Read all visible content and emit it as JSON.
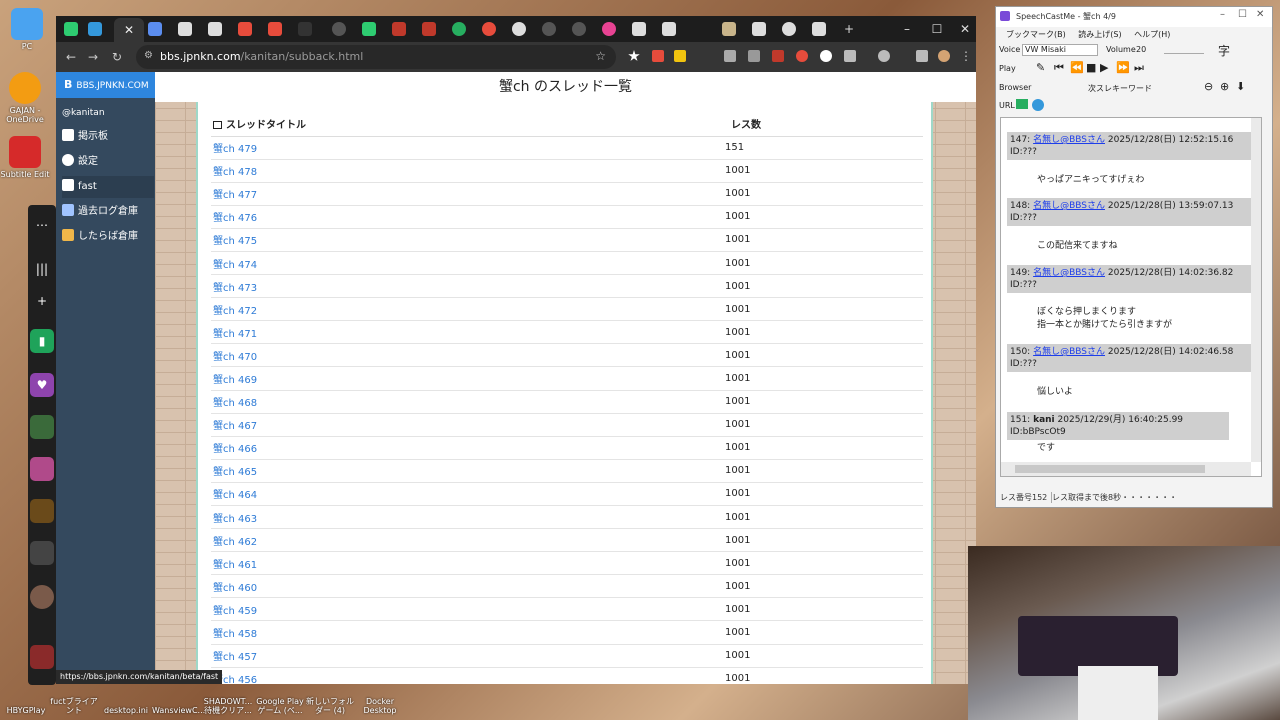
{
  "desktop": {
    "icons": [
      "PC",
      "GAJAN - OneDrive",
      "Subtitle Edit"
    ],
    "bottom_labels": [
      "HBYGPlay",
      "fuctブライアント",
      "desktop.ini",
      "WansviewC...",
      "SHADOWT... 待機クリア...",
      "Google Play ゲーム (ベ...",
      "新しいフォルダー (4)",
      "Docker Desktop"
    ]
  },
  "chrome": {
    "url_host": "bbs.jpnkn.com",
    "url_path": "/kanitan/subback.html",
    "status_url": "https://bbs.jpnkn.com/kanitan/beta/fast"
  },
  "sidebar": {
    "brand_mark": "B",
    "brand_name": "BBS.JPNKN.COM",
    "user": "@kanitan",
    "items": [
      {
        "label": "掲示板",
        "icon": "home-icon"
      },
      {
        "label": "設定",
        "icon": "gear-icon"
      },
      {
        "label": "fast",
        "icon": "rocket-icon"
      },
      {
        "label": "過去ログ倉庫",
        "icon": "archive-icon"
      },
      {
        "label": "したらば倉庫",
        "icon": "archive-icon"
      }
    ]
  },
  "page": {
    "title": "蟹ch のスレッド一覧",
    "col_title": "スレッドタイトル",
    "col_count": "レス数",
    "threads": [
      {
        "title": "蟹ch 479",
        "count": "151"
      },
      {
        "title": "蟹ch 478",
        "count": "1001"
      },
      {
        "title": "蟹ch 477",
        "count": "1001"
      },
      {
        "title": "蟹ch 476",
        "count": "1001"
      },
      {
        "title": "蟹ch 475",
        "count": "1001"
      },
      {
        "title": "蟹ch 474",
        "count": "1001"
      },
      {
        "title": "蟹ch 473",
        "count": "1001"
      },
      {
        "title": "蟹ch 472",
        "count": "1001"
      },
      {
        "title": "蟹ch 471",
        "count": "1001"
      },
      {
        "title": "蟹ch 470",
        "count": "1001"
      },
      {
        "title": "蟹ch 469",
        "count": "1001"
      },
      {
        "title": "蟹ch 468",
        "count": "1001"
      },
      {
        "title": "蟹ch 467",
        "count": "1001"
      },
      {
        "title": "蟹ch 466",
        "count": "1001"
      },
      {
        "title": "蟹ch 465",
        "count": "1001"
      },
      {
        "title": "蟹ch 464",
        "count": "1001"
      },
      {
        "title": "蟹ch 463",
        "count": "1001"
      },
      {
        "title": "蟹ch 462",
        "count": "1001"
      },
      {
        "title": "蟹ch 461",
        "count": "1001"
      },
      {
        "title": "蟹ch 460",
        "count": "1001"
      },
      {
        "title": "蟹ch 459",
        "count": "1001"
      },
      {
        "title": "蟹ch 458",
        "count": "1001"
      },
      {
        "title": "蟹ch 457",
        "count": "1001"
      },
      {
        "title": "蟹ch 456",
        "count": "1001"
      }
    ]
  },
  "scm": {
    "title": "SpeechCastMe - 蟹ch 4/9",
    "menu": [
      "ブックマーク(B)",
      "読み上げ(S)",
      "ヘルプ(H)"
    ],
    "voice_label": "Voice",
    "voice_value": "VW Misaki",
    "volume_label": "Volume",
    "volume_value": "20",
    "char_label": "字",
    "play_label": "Play",
    "browser_label": "Browser",
    "keyword_label": "次スレキーワード",
    "url_label": "URL",
    "posts": [
      {
        "no": "147:",
        "name": "名無し@BBSさん",
        "date": "2025/12/28(日) 12:52:15.16",
        "id": "ID:???",
        "body": [
          "やっぱアニキってすげぇわ"
        ]
      },
      {
        "no": "148:",
        "name": "名無し@BBSさん",
        "date": "2025/12/28(日) 13:59:07.13",
        "id": "ID:???",
        "body": [
          "この配信来てますね"
        ]
      },
      {
        "no": "149:",
        "name": "名無し@BBSさん",
        "date": "2025/12/28(日) 14:02:36.82",
        "id": "ID:???",
        "body": [
          "ぼくなら押しまくります",
          "指一本とか賭けてたら引きますが"
        ]
      },
      {
        "no": "150:",
        "name": "名無し@BBSさん",
        "date": "2025/12/28(日) 14:02:46.58",
        "id": "ID:???",
        "body": [
          "悩しいよ"
        ]
      },
      {
        "no": "151:",
        "name": "kani",
        "date": "2025/12/29(月) 16:40:25.99",
        "id": "ID:bBPscOt9",
        "body": [
          "です"
        ]
      }
    ],
    "status_left": "レス番号152",
    "status_right": "レス取得まで後8秒・・・・・・・"
  }
}
